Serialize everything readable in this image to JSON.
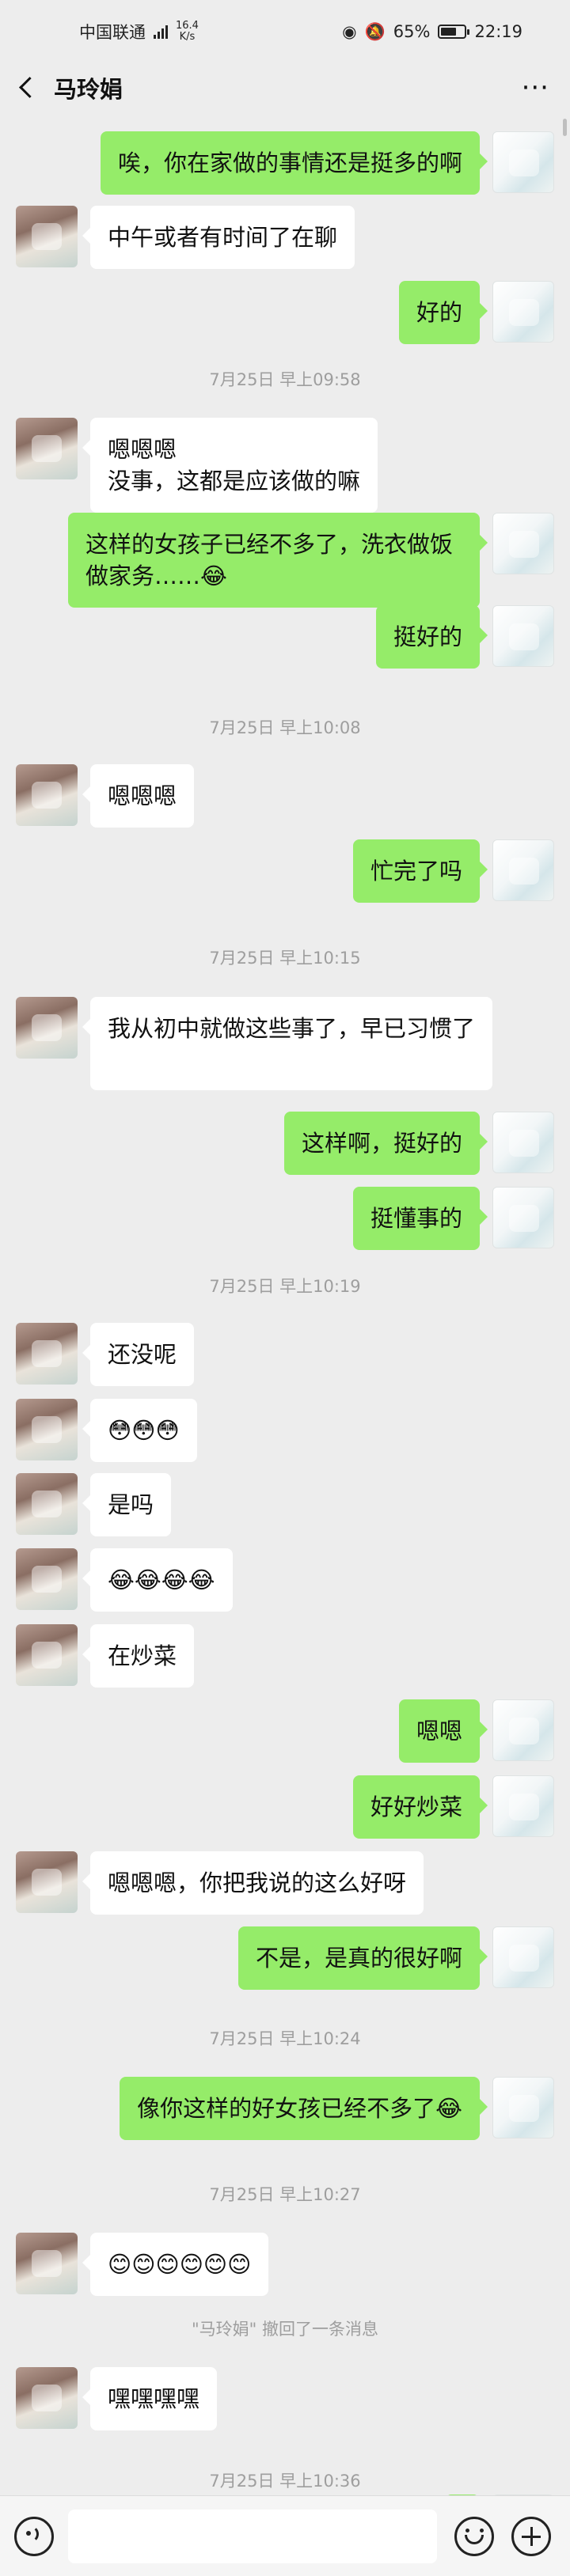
{
  "status_bar": {
    "carrier": "中国联通",
    "network_speed": "16.4\nK/s",
    "battery": "65%",
    "battery_level": 0.65,
    "time": "22:19"
  },
  "header": {
    "title": "马玲娟"
  },
  "messages": [
    {
      "type": "msg",
      "side": "right",
      "text": "唉，你在家做的事情还是挺多的啊"
    },
    {
      "type": "msg",
      "side": "left",
      "text": "中午或者有时间了在聊"
    },
    {
      "type": "msg",
      "side": "right",
      "text": "好的"
    },
    {
      "type": "time",
      "text": "7月25日 早上09:58"
    },
    {
      "type": "msg",
      "side": "left",
      "text": "嗯嗯嗯\n没事，这都是应该做的嘛"
    },
    {
      "type": "msg",
      "side": "right",
      "text": "这样的女孩子已经不多了，洗衣做饭做家务……😂"
    },
    {
      "type": "msg",
      "side": "right",
      "text": "挺好的"
    },
    {
      "type": "time",
      "text": "7月25日 早上10:08"
    },
    {
      "type": "msg",
      "side": "left",
      "text": "嗯嗯嗯"
    },
    {
      "type": "msg",
      "side": "right",
      "text": "忙完了吗"
    },
    {
      "type": "time",
      "text": "7月25日 早上10:15"
    },
    {
      "type": "msg",
      "side": "left",
      "text": "我从初中就做这些事了，早已习惯了"
    },
    {
      "type": "msg",
      "side": "right",
      "text": "这样啊，挺好的"
    },
    {
      "type": "msg",
      "side": "right",
      "text": "挺懂事的"
    },
    {
      "type": "time",
      "text": "7月25日 早上10:19"
    },
    {
      "type": "msg",
      "side": "left",
      "text": "还没呢"
    },
    {
      "type": "msg",
      "side": "left",
      "text": "😳😳😳"
    },
    {
      "type": "msg",
      "side": "left",
      "text": "是吗"
    },
    {
      "type": "msg",
      "side": "left",
      "text": "😂😂😂😂"
    },
    {
      "type": "msg",
      "side": "left",
      "text": "在炒菜"
    },
    {
      "type": "msg",
      "side": "right",
      "text": "嗯嗯"
    },
    {
      "type": "msg",
      "side": "right",
      "text": "好好炒菜"
    },
    {
      "type": "msg",
      "side": "left",
      "text": "嗯嗯嗯，你把我说的这么好呀"
    },
    {
      "type": "msg",
      "side": "right",
      "text": "不是，是真的很好啊"
    },
    {
      "type": "time",
      "text": "7月25日 早上10:24"
    },
    {
      "type": "msg",
      "side": "right",
      "text": "像你这样的好女孩已经不多了😂"
    },
    {
      "type": "time",
      "text": "7月25日 早上10:27"
    },
    {
      "type": "msg",
      "side": "left",
      "text": "😊😊😊😊😊😊"
    },
    {
      "type": "time",
      "text": "\"马玲娟\" 撤回了一条消息"
    },
    {
      "type": "msg",
      "side": "left",
      "text": "嘿嘿嘿嘿"
    },
    {
      "type": "time",
      "text": "7月25日 早上10:36"
    },
    {
      "type": "msg",
      "side": "right",
      "text": ""
    }
  ],
  "input_bar": {
    "voice_icon": "voice-icon",
    "emoji_icon": "emoji-icon",
    "plus_icon": "plus-icon"
  }
}
